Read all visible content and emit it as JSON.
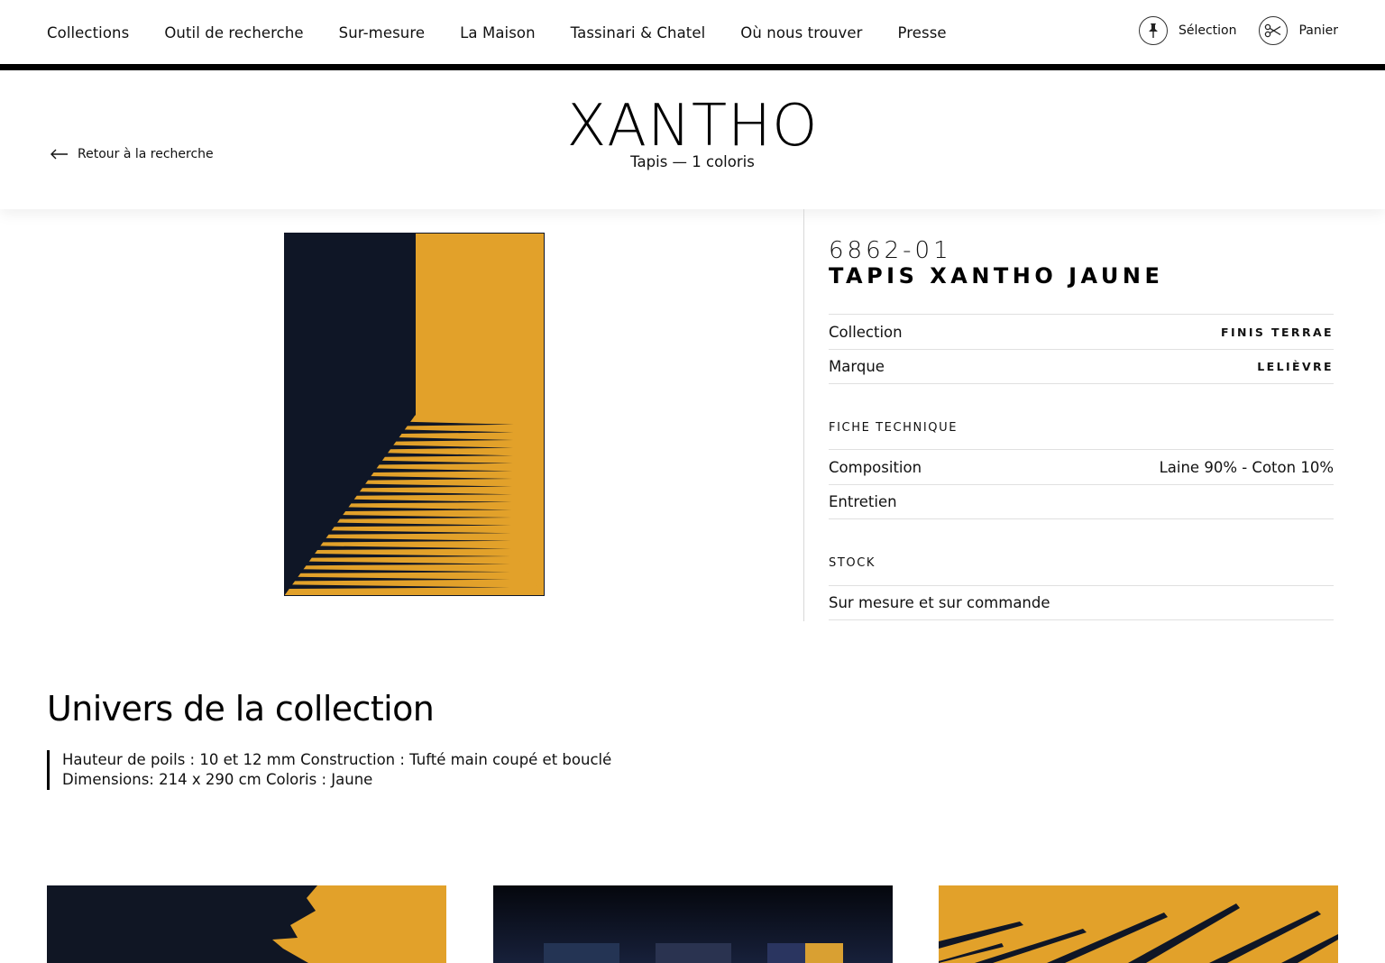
{
  "nav": {
    "links": [
      "Collections",
      "Outil de recherche",
      "Sur-mesure",
      "La Maison",
      "Tassinari & Chatel",
      "Où nous trouver",
      "Presse"
    ],
    "selection_label": "Sélection",
    "cart_label": "Panier",
    "selection_icon": "pin-icon",
    "cart_icon": "scissors-icon"
  },
  "header": {
    "back_label": "Retour à la recherche",
    "title": "XANTHO",
    "subtitle": "Tapis — 1 coloris"
  },
  "product": {
    "reference": "6862-01",
    "name": "TAPIS XANTHO JAUNE",
    "colors": {
      "navy": "#0f1626",
      "mustard": "#e2a12a"
    },
    "attributes": [
      {
        "label": "Collection",
        "value": "FINIS TERRAE"
      },
      {
        "label": "Marque",
        "value": "LELIÈVRE"
      }
    ],
    "fiche_technique_label": "FICHE TECHNIQUE",
    "fiche_technique": [
      {
        "label": "Composition",
        "value": "Laine 90% - Coton 10%"
      },
      {
        "label": "Entretien",
        "value": ""
      }
    ],
    "stock_label": "STOCK",
    "stock_value": "Sur mesure et sur commande"
  },
  "univers": {
    "title": "Univers de la collection",
    "lines": [
      "Hauteur de poils : 10 et 12 mm Construction : Tufté main coupé et bouclé",
      "Dimensions: 214 x 290 cm Coloris : Jaune"
    ]
  },
  "gallery": {
    "count": 3
  }
}
